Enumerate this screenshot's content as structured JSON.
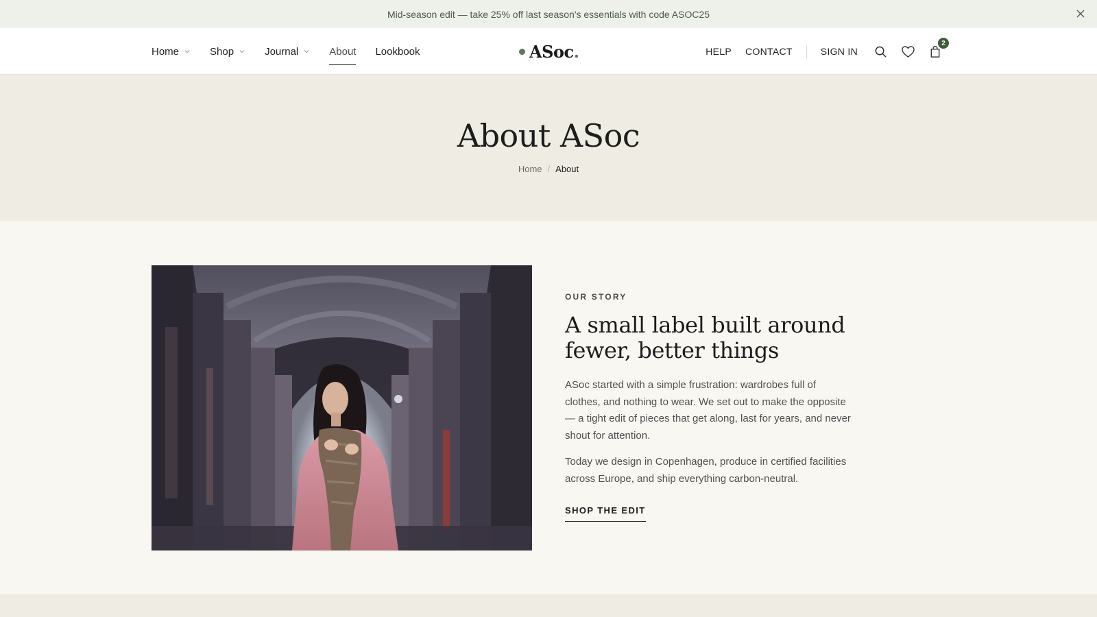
{
  "announcement": {
    "text": "Mid-season edit — take 25% off last season's essentials with code ASOC25",
    "close_icon": "close-icon"
  },
  "nav": {
    "left": [
      {
        "label": "Home",
        "has_dropdown": true
      },
      {
        "label": "Shop",
        "has_dropdown": true
      },
      {
        "label": "Journal",
        "has_dropdown": true
      },
      {
        "label": "About",
        "has_dropdown": false,
        "active": true
      },
      {
        "label": "Lookbook",
        "has_dropdown": false
      }
    ],
    "right": {
      "help": "HELP",
      "contact": "CONTACT",
      "sign_in": "SIGN IN",
      "cart_count": "2",
      "icons": [
        "search-icon",
        "heart-icon",
        "bag-icon"
      ]
    }
  },
  "brand": {
    "name": "ASoc",
    "suffix": ".",
    "accent_color": "#5b7a55"
  },
  "hero": {
    "title": "About ASoc",
    "breadcrumb": {
      "home": "Home",
      "separator": "/",
      "current": "About"
    }
  },
  "story": {
    "eyebrow": "OUR STORY",
    "heading": "A small label built around fewer, better things",
    "paragraph_1": "ASoc started with a simple frustration: wardrobes full of clothes, and nothing to wear. We set out to make the opposite — a tight edit of pieces that get along, last for years, and never shout for attention.",
    "paragraph_2": "Today we design in Copenhagen, produce in certified facilities across Europe, and ship everything carbon-neutral.",
    "cta": "SHOP THE EDIT"
  },
  "colors": {
    "announcement_bg": "#eef0ea",
    "hero_bg": "#efede3",
    "page_bg": "#f8f7f2",
    "badge": "#3e5c3c"
  }
}
